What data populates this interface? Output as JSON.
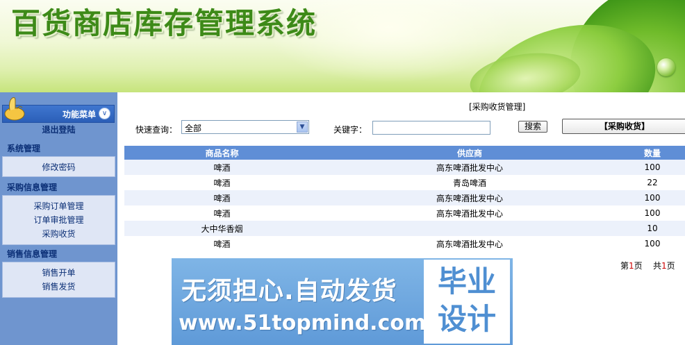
{
  "header": {
    "title": "百货商店库存管理系统"
  },
  "sidebar": {
    "menu_title": "功能菜单",
    "logout": "退出登陆",
    "sections": [
      {
        "title": "系统管理",
        "items": [
          "修改密码"
        ]
      },
      {
        "title": "采购信息管理",
        "items": [
          "采购订单管理",
          "订单审批管理",
          "采购收货"
        ]
      },
      {
        "title": "销售信息管理",
        "items": [
          "销售开单",
          "销售发货"
        ]
      }
    ]
  },
  "main": {
    "page_title": "[采购收货管理]",
    "quick_query_label": "快速查询：",
    "quick_query_value": "全部",
    "keyword_label": "关键字：",
    "keyword_value": "",
    "search_button": "搜索",
    "receive_button": "【采购收货】",
    "table": {
      "headers": [
        "商品名称",
        "供应商",
        "数量"
      ],
      "rows": [
        [
          "啤酒",
          "高东啤酒批发中心",
          "100"
        ],
        [
          "啤酒",
          "青岛啤酒",
          "22"
        ],
        [
          "啤酒",
          "高东啤酒批发中心",
          "100"
        ],
        [
          "啤酒",
          "高东啤酒批发中心",
          "100"
        ],
        [
          "大中华香烟",
          "",
          "10"
        ],
        [
          "啤酒",
          "高东啤酒批发中心",
          "100"
        ]
      ]
    },
    "pager": {
      "page_prefix": "第",
      "page_num": "1",
      "page_suffix": "页",
      "total_prefix": "共",
      "total_num": "1",
      "total_suffix": "页"
    }
  },
  "watermark": {
    "line1": "无须担心.自动发货",
    "line2": "www.51topmind.com",
    "box_line1": "毕业",
    "box_line2": "设计"
  },
  "colors": {
    "sidebar_bg": "#6f95cf",
    "table_header": "#5f8ed6",
    "title_green": "#3d8a18",
    "watermark_bg": "#6aa4dc"
  }
}
